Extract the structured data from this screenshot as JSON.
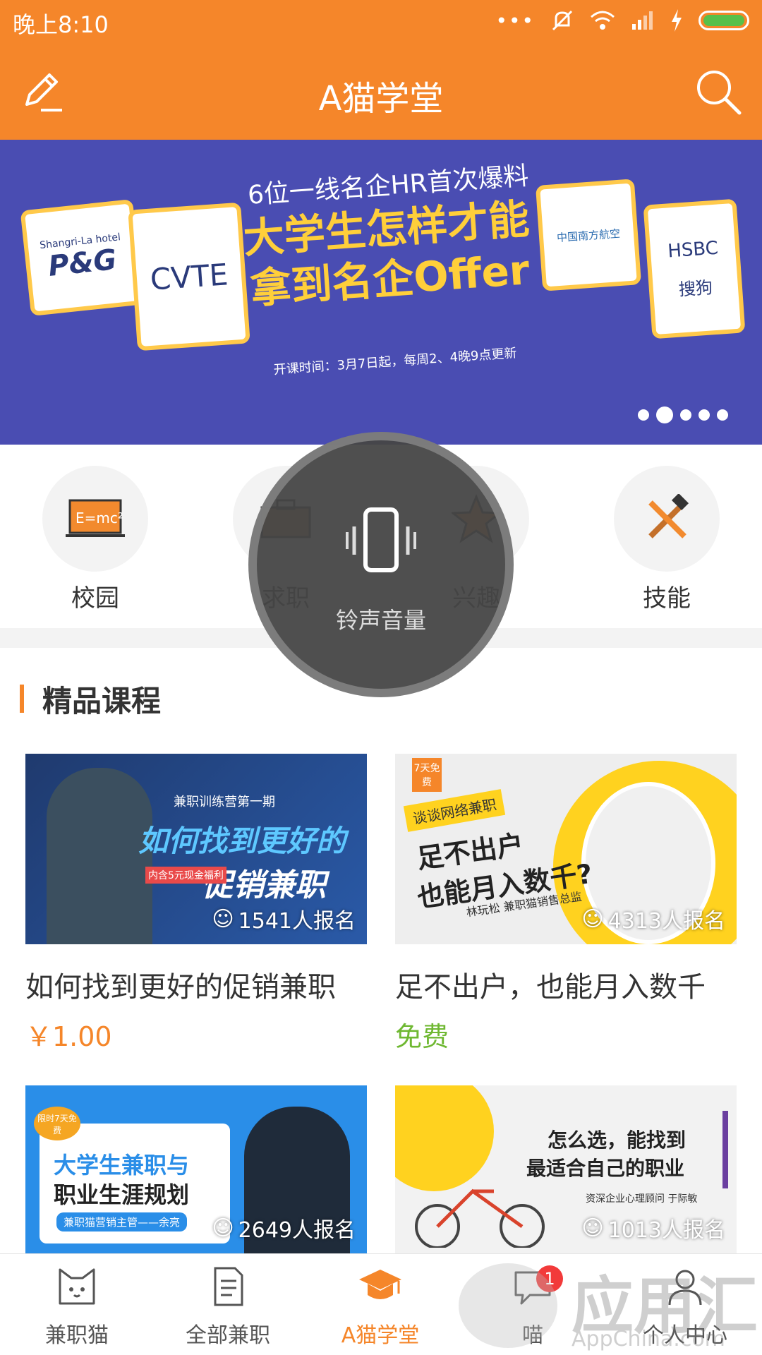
{
  "status_bar": {
    "time": "晚上8:10",
    "battery_color": "#58c04a"
  },
  "app_bar": {
    "title": "A猫学堂",
    "left_icon": "edit-icon",
    "right_icon": "search-icon",
    "color": "#f5862a"
  },
  "banner": {
    "subtitle": "6位一线名企HR首次爆料",
    "headline": "大学生怎样才能拿到名企Offer",
    "note": "开课时间：3月7日起，每周2、4晚9点更新",
    "logos": [
      "Shangri-La hotel",
      "P&G",
      "CVTE",
      "中国南方航空",
      "HSBC",
      "搜狗"
    ],
    "page_count": 5,
    "active_page": 2
  },
  "categories": [
    {
      "label": "校园",
      "icon": "blackboard-icon"
    },
    {
      "label": "求职",
      "icon": "briefcase-icon"
    },
    {
      "label": "兴趣",
      "icon": "star-icon"
    },
    {
      "label": "技能",
      "icon": "tools-icon"
    }
  ],
  "section": {
    "title": "精品课程"
  },
  "courses": [
    {
      "title": "如何找到更好的促销兼职",
      "price": "￥1.00",
      "enroll": "1541人报名",
      "thumb_text": [
        "兼职训练营第一期",
        "如何找到更好的",
        "促销兼职",
        "内含5元现金福利"
      ]
    },
    {
      "title": "足不出户，也能月入数千",
      "price": "免费",
      "enroll": "4313人报名",
      "thumb_text": [
        "7天免费",
        "谈谈网络兼职",
        "足不出户",
        "也能月入数千?",
        "林玩松 兼职猫销售总监"
      ]
    },
    {
      "title": "",
      "price": "",
      "enroll": "2649人报名",
      "thumb_text": [
        "限时7天免费",
        "大学生兼职与",
        "职业生涯规划",
        "兼职猫营销主管——余亮"
      ]
    },
    {
      "title": "",
      "price": "",
      "enroll": "1013人报名",
      "thumb_text": [
        "怎么选，能找到",
        "最适合自己的职业",
        "资深企业心理顾问 于际敏"
      ]
    }
  ],
  "volume_overlay": {
    "label": "铃声音量",
    "icon": "vibrate-phone-icon"
  },
  "tab_bar": [
    {
      "label": "兼职猫",
      "icon": "cat-icon",
      "active": false
    },
    {
      "label": "全部兼职",
      "icon": "document-icon",
      "active": false
    },
    {
      "label": "A猫学堂",
      "icon": "graduation-cap-icon",
      "active": true
    },
    {
      "label": "喵",
      "icon": "chat-icon",
      "active": false,
      "badge": "1"
    },
    {
      "label": "个人中心",
      "icon": "person-icon",
      "active": false
    }
  ],
  "watermark": {
    "main": "应用汇",
    "sub": "AppChina.com"
  }
}
